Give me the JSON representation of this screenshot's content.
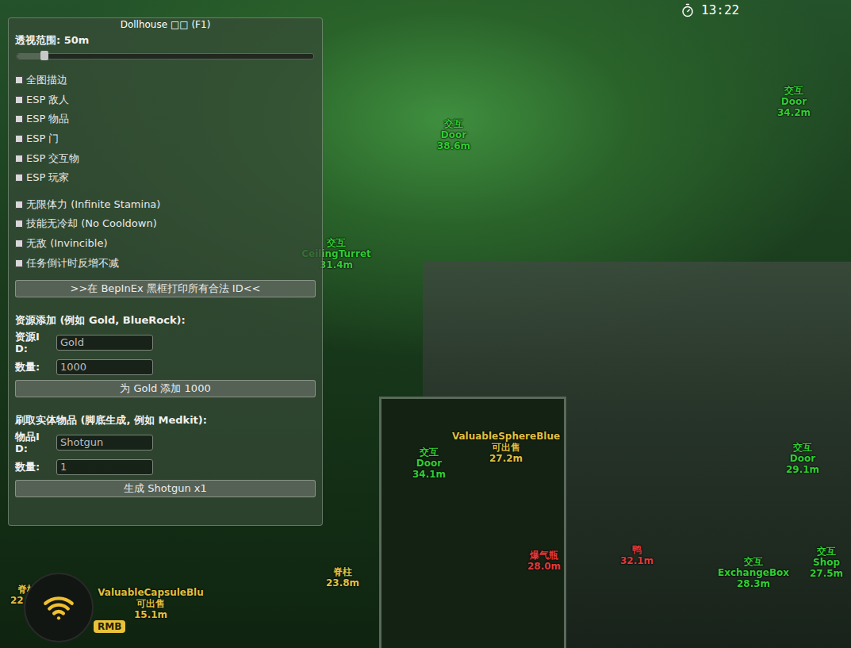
{
  "panel": {
    "title": "Dollhouse □□ (F1)",
    "range": {
      "label": "透视范围: 50m",
      "level": 0.09
    },
    "esp_toggles": [
      {
        "label": "全图描边",
        "checked": false
      },
      {
        "label": "ESP 敌人",
        "checked": false
      },
      {
        "label": "ESP 物品",
        "checked": false
      },
      {
        "label": "ESP 门",
        "checked": false
      },
      {
        "label": "ESP 交互物",
        "checked": false
      },
      {
        "label": "ESP 玩家",
        "checked": false
      }
    ],
    "cheat_toggles": [
      {
        "label": "无限体力 (Infinite Stamina)",
        "checked": false
      },
      {
        "label": "技能无冷却 (No Cooldown)",
        "checked": false
      },
      {
        "label": "无敌 (Invincible)",
        "checked": false
      },
      {
        "label": "任务倒计时反增不减",
        "checked": false
      }
    ],
    "print_button": ">>在 BepInEx 黑框打印所有合法 ID<<",
    "resource": {
      "heading": "资源添加 (例如 Gold, BlueRock):",
      "id_label": "资源ID:",
      "id_value": "Gold",
      "count_label": "数量:",
      "count_value": "1000",
      "button": "为 Gold 添加 1000"
    },
    "spawn": {
      "heading": "刷取实体物品 (脚底生成, 例如 Medkit):",
      "id_label": "物品ID:",
      "id_value": "Shotgun",
      "count_label": "数量:",
      "count_value": "1",
      "button": "生成 Shotgun x1"
    }
  },
  "hud": {
    "timer": "13:22",
    "badge": "RMB"
  },
  "esp_labels": [
    {
      "lines": [
        "交互",
        "Door",
        "38.6m"
      ],
      "color": "#33cc33"
    },
    {
      "lines": [
        "交互",
        "Door",
        "34.2m"
      ],
      "color": "#33cc33"
    },
    {
      "lines": [
        "交互",
        "CeilingTurret",
        "31.4m"
      ],
      "color": "#33cc33"
    },
    {
      "lines": [
        "交互",
        "Door",
        "34.1m"
      ],
      "color": "#33cc33"
    },
    {
      "lines": [
        "ValuableSphereBlue",
        "可出售",
        "27.2m"
      ],
      "color": "#e0c040"
    },
    {
      "lines": [
        "交互",
        "Door",
        "29.1m"
      ],
      "color": "#33cc33"
    },
    {
      "lines": [
        "交互",
        "ExchangeBox",
        "28.3m"
      ],
      "color": "#33cc33"
    },
    {
      "lines": [
        "交互",
        "Shop",
        "27.5m"
      ],
      "color": "#33cc33"
    },
    {
      "lines": [
        "爆气瓶",
        "28.0m"
      ],
      "color": "#e03a3a"
    },
    {
      "lines": [
        "鸭",
        "32.1m"
      ],
      "color": "#e03a3a"
    },
    {
      "lines": [
        "脊柱",
        "23.8m"
      ],
      "color": "#e0c040"
    },
    {
      "lines": [
        "脊柱",
        "22.3m"
      ],
      "color": "#e0c040"
    },
    {
      "lines": [
        "ValuableCapsuleBlu",
        "可出售",
        "15.1m"
      ],
      "color": "#e0c040"
    }
  ]
}
